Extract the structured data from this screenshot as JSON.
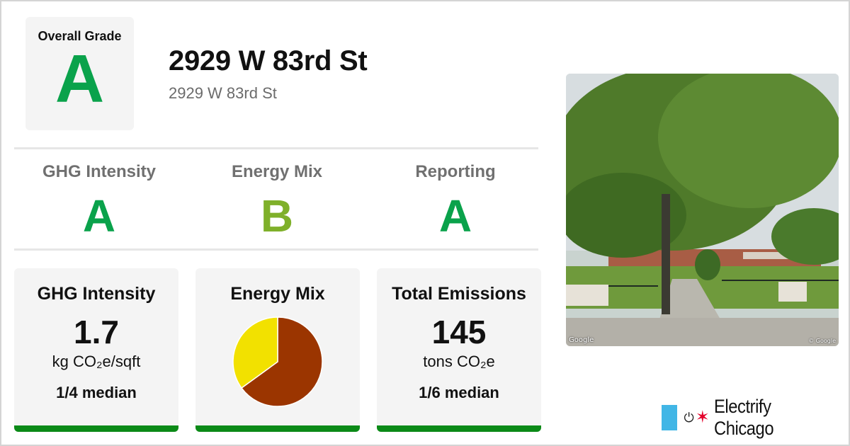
{
  "overall": {
    "label": "Overall Grade",
    "grade": "A",
    "color": "#0aa24b"
  },
  "header": {
    "title": "2929 W 83rd St",
    "subtitle": "2929 W 83rd St"
  },
  "subgrades": [
    {
      "label": "GHG Intensity",
      "grade": "A",
      "color": "#0aa24b"
    },
    {
      "label": "Energy Mix",
      "grade": "B",
      "color": "#7fb02a"
    },
    {
      "label": "Reporting",
      "grade": "A",
      "color": "#0aa24b"
    }
  ],
  "stats": {
    "ghg": {
      "title": "GHG Intensity",
      "value": "1.7",
      "unit": "kg CO₂e/sqft",
      "median": "1/4 median"
    },
    "mix": {
      "title": "Energy Mix"
    },
    "emissions": {
      "title": "Total Emissions",
      "value": "145",
      "unit": "tons CO₂e",
      "median": "1/6 median"
    }
  },
  "chart_data": {
    "type": "pie",
    "slices": [
      {
        "value": 65,
        "color": "#9b3500"
      },
      {
        "value": 35,
        "color": "#f2e100"
      }
    ]
  },
  "photo": {
    "attribution_left": "Google",
    "attribution_right": "© Google"
  },
  "brand": {
    "name": "Electrify Chicago",
    "accent": "#41b6e6",
    "star_color": "#e4002b",
    "icons": [
      "plug-icon",
      "star-icon"
    ]
  },
  "colors": {
    "grade_bar": "#0b8a17"
  }
}
